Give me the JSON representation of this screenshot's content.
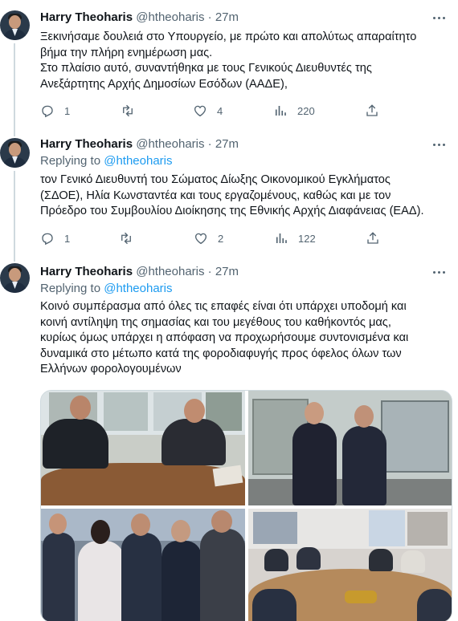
{
  "tweets": [
    {
      "name": "Harry Theoharis",
      "handle": "@htheoharis",
      "time": "27m",
      "replying_prefix": "",
      "replying_to": "",
      "lines": [
        "Ξεκινήσαμε δουλειά στο Υπουργείο, με πρώτο και απολύτως απαραίτητο",
        "βήμα την πλήρη ενημέρωση μας.",
        "Στο πλαίσιο αυτό, συναντήθηκα με τους Γενικούς Διευθυντές της",
        "Ανεξάρτητης Αρχής Δημοσίων Εσόδων (ΑΑΔΕ),"
      ],
      "replies": "1",
      "retweets": "",
      "likes": "4",
      "views": "220"
    },
    {
      "name": "Harry Theoharis",
      "handle": "@htheoharis",
      "time": "27m",
      "replying_prefix": "Replying to ",
      "replying_to": "@htheoharis",
      "lines": [
        "τον Γενικό Διευθυντή του Σώματος Δίωξης Οικονομικού Εγκλήματος",
        "(ΣΔΟΕ), Ηλία Κωνσταντέα και τους εργαζομένους, καθώς και με τον",
        "Πρόεδρο του Συμβουλίου Διοίκησης της Εθνικής Αρχής Διαφάνειας (ΕΑΔ)."
      ],
      "replies": "1",
      "retweets": "",
      "likes": "2",
      "views": "122"
    },
    {
      "name": "Harry Theoharis",
      "handle": "@htheoharis",
      "time": "27m",
      "replying_prefix": "Replying to ",
      "replying_to": "@htheoharis",
      "lines": [
        "Κοινό συμπέρασμα από όλες τις επαφές είναι ότι υπάρχει υποδομή και",
        "κοινή αντίληψη της σημασίας και του μεγέθους του καθήκοντός μας,",
        "κυρίως όμως υπάρχει η απόφαση να προχωρήσουμε συντονισμένα και",
        "δυναμικά στο μέτωπο κατά της φοροδιαφυγής προς όφελος όλων των",
        "Ελλήνων φορολογουμένων"
      ]
    }
  ],
  "media": {
    "photos": [
      "meeting-table-photo",
      "handshake-office-photo",
      "group-handshake-photo",
      "conference-room-photo"
    ]
  },
  "colors": {
    "text": "#0f1419",
    "secondary": "#536471",
    "link": "#1d9bf0",
    "line": "#cfd9de"
  },
  "icons": [
    "more-icon",
    "reply-icon",
    "retweet-icon",
    "like-icon",
    "views-icon",
    "share-icon"
  ]
}
